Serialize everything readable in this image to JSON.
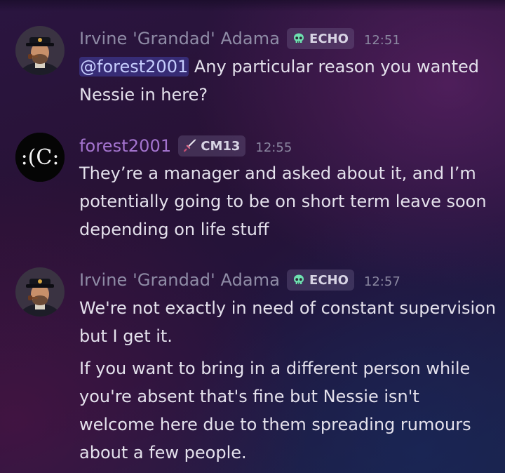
{
  "messages": [
    {
      "author": "Irvine 'Grandad' Adama",
      "tag": {
        "icon": "skull-icon",
        "label": "ECHO"
      },
      "time": "12:51",
      "mention": "@forest2001",
      "text": " Any particular reason you wanted Nessie in here?"
    },
    {
      "author": "forest2001",
      "tag": {
        "icon": "sword-icon",
        "label": "CM13"
      },
      "time": "12:55",
      "avatar_text": ":(C:",
      "text": "They’re a manager and asked about it, and I’m potentially going to be on short term leave soon depending on life stuff"
    },
    {
      "author": "Irvine 'Grandad' Adama",
      "tag": {
        "icon": "skull-icon",
        "label": "ECHO"
      },
      "time": "12:57",
      "paragraphs": [
        "We're not exactly in need of constant supervision but I get it.",
        "If you want to bring in a different person while you're absent that's fine but Nessie isn't welcome here due to them spreading rumours about a few people."
      ]
    }
  ],
  "colors": {
    "author_grey": "#8f8ca6",
    "author_purple": "#a474cf",
    "mention_bg": "#5865f2",
    "skull": "#6ee0b0"
  }
}
